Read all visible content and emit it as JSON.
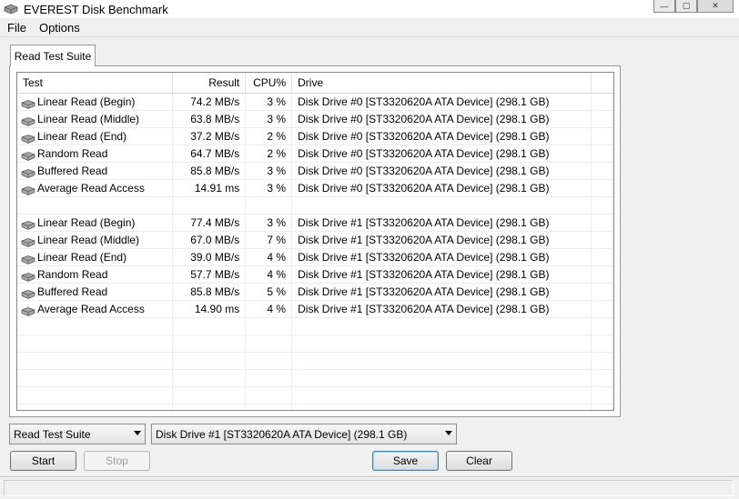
{
  "window": {
    "title": "EVEREST Disk Benchmark",
    "controls": {
      "minimize": "—",
      "maximize": "▢",
      "close": "✕"
    }
  },
  "menu": [
    "File",
    "Options"
  ],
  "tabs": [
    {
      "label": "Read Test Suite",
      "active": true
    }
  ],
  "list": {
    "columns": {
      "test": "Test",
      "result": "Result",
      "cpu": "CPU%",
      "drive": "Drive"
    },
    "rows": [
      {
        "test": "Linear Read (Begin)",
        "result": "74.2 MB/s",
        "cpu": "3 %",
        "drive": "Disk Drive #0  [ST3320620A ATA Device]  (298.1 GB)"
      },
      {
        "test": "Linear Read (Middle)",
        "result": "63.8 MB/s",
        "cpu": "3 %",
        "drive": "Disk Drive #0  [ST3320620A ATA Device]  (298.1 GB)"
      },
      {
        "test": "Linear Read (End)",
        "result": "37.2 MB/s",
        "cpu": "2 %",
        "drive": "Disk Drive #0  [ST3320620A ATA Device]  (298.1 GB)"
      },
      {
        "test": "Random Read",
        "result": "64.7 MB/s",
        "cpu": "2 %",
        "drive": "Disk Drive #0  [ST3320620A ATA Device]  (298.1 GB)"
      },
      {
        "test": "Buffered Read",
        "result": "85.8 MB/s",
        "cpu": "3 %",
        "drive": "Disk Drive #0  [ST3320620A ATA Device]  (298.1 GB)"
      },
      {
        "test": "Average Read Access",
        "result": "14.91 ms",
        "cpu": "3 %",
        "drive": "Disk Drive #0  [ST3320620A ATA Device]  (298.1 GB)"
      },
      {
        "test": "",
        "result": "",
        "cpu": "",
        "drive": ""
      },
      {
        "test": "Linear Read (Begin)",
        "result": "77.4 MB/s",
        "cpu": "3 %",
        "drive": "Disk Drive #1  [ST3320620A ATA Device]  (298.1 GB)"
      },
      {
        "test": "Linear Read (Middle)",
        "result": "67.0 MB/s",
        "cpu": "7 %",
        "drive": "Disk Drive #1  [ST3320620A ATA Device]  (298.1 GB)"
      },
      {
        "test": "Linear Read (End)",
        "result": "39.0 MB/s",
        "cpu": "4 %",
        "drive": "Disk Drive #1  [ST3320620A ATA Device]  (298.1 GB)"
      },
      {
        "test": "Random Read",
        "result": "57.7 MB/s",
        "cpu": "4 %",
        "drive": "Disk Drive #1  [ST3320620A ATA Device]  (298.1 GB)"
      },
      {
        "test": "Buffered Read",
        "result": "85.8 MB/s",
        "cpu": "5 %",
        "drive": "Disk Drive #1  [ST3320620A ATA Device]  (298.1 GB)"
      },
      {
        "test": "Average Read Access",
        "result": "14.90 ms",
        "cpu": "4 %",
        "drive": "Disk Drive #1  [ST3320620A ATA Device]  (298.1 GB)"
      },
      {
        "test": "",
        "result": "",
        "cpu": "",
        "drive": ""
      },
      {
        "test": "",
        "result": "",
        "cpu": "",
        "drive": ""
      },
      {
        "test": "",
        "result": "",
        "cpu": "",
        "drive": ""
      },
      {
        "test": "",
        "result": "",
        "cpu": "",
        "drive": ""
      },
      {
        "test": "",
        "result": "",
        "cpu": "",
        "drive": ""
      },
      {
        "test": "",
        "result": "",
        "cpu": "",
        "drive": ""
      }
    ]
  },
  "controls": {
    "suite_select": "Read Test Suite",
    "drive_select": "Disk Drive #1  [ST3320620A ATA Device]  (298.1 GB)",
    "start_label": "Start",
    "stop_label": "Stop",
    "save_label": "Save",
    "clear_label": "Clear"
  },
  "status": {
    "text": ""
  }
}
